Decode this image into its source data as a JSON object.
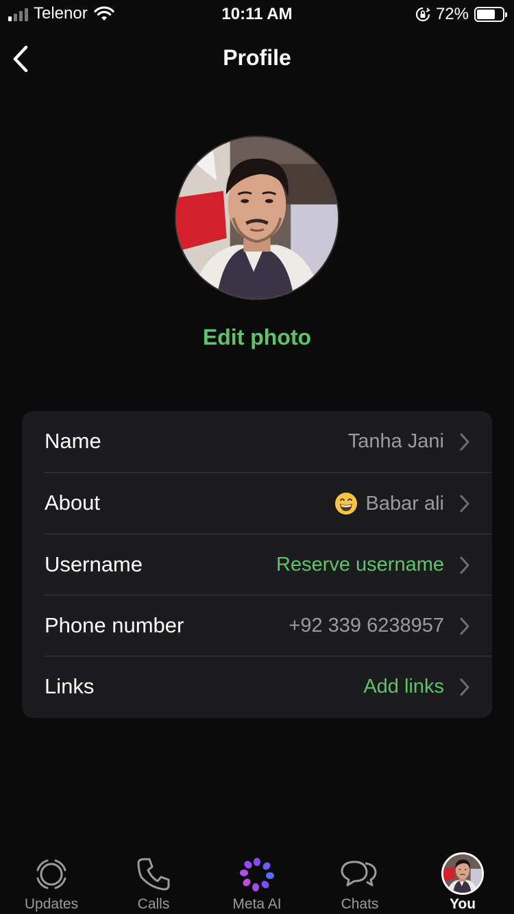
{
  "status_bar": {
    "carrier": "Telenor",
    "time": "10:11 AM",
    "battery_percent": "72%",
    "battery_level": 0.72
  },
  "header": {
    "title": "Profile",
    "back_icon": "chevron-left-icon"
  },
  "profile": {
    "edit_photo_label": "Edit photo"
  },
  "rows": [
    {
      "label": "Name",
      "value": "Tanha Jani",
      "accent": false
    },
    {
      "label": "About",
      "value": "Babar ali",
      "emoji": "grinning-face-icon",
      "accent": false
    },
    {
      "label": "Username",
      "value": "Reserve username",
      "accent": true
    },
    {
      "label": "Phone number",
      "value": "+92 339 6238957",
      "accent": false
    },
    {
      "label": "Links",
      "value": "Add links",
      "accent": true
    }
  ],
  "tabs": [
    {
      "label": "Updates",
      "icon": "updates-icon",
      "active": false
    },
    {
      "label": "Calls",
      "icon": "phone-icon",
      "active": false
    },
    {
      "label": "Meta AI",
      "icon": "meta-ai-icon",
      "active": false
    },
    {
      "label": "Chats",
      "icon": "chat-bubbles-icon",
      "active": false
    },
    {
      "label": "You",
      "icon": "profile-avatar",
      "active": true
    }
  ],
  "colors": {
    "accent": "#5ec36b",
    "background": "#0b0b0b",
    "card": "#1c1c1e",
    "secondary_text": "#9b9b9f"
  }
}
